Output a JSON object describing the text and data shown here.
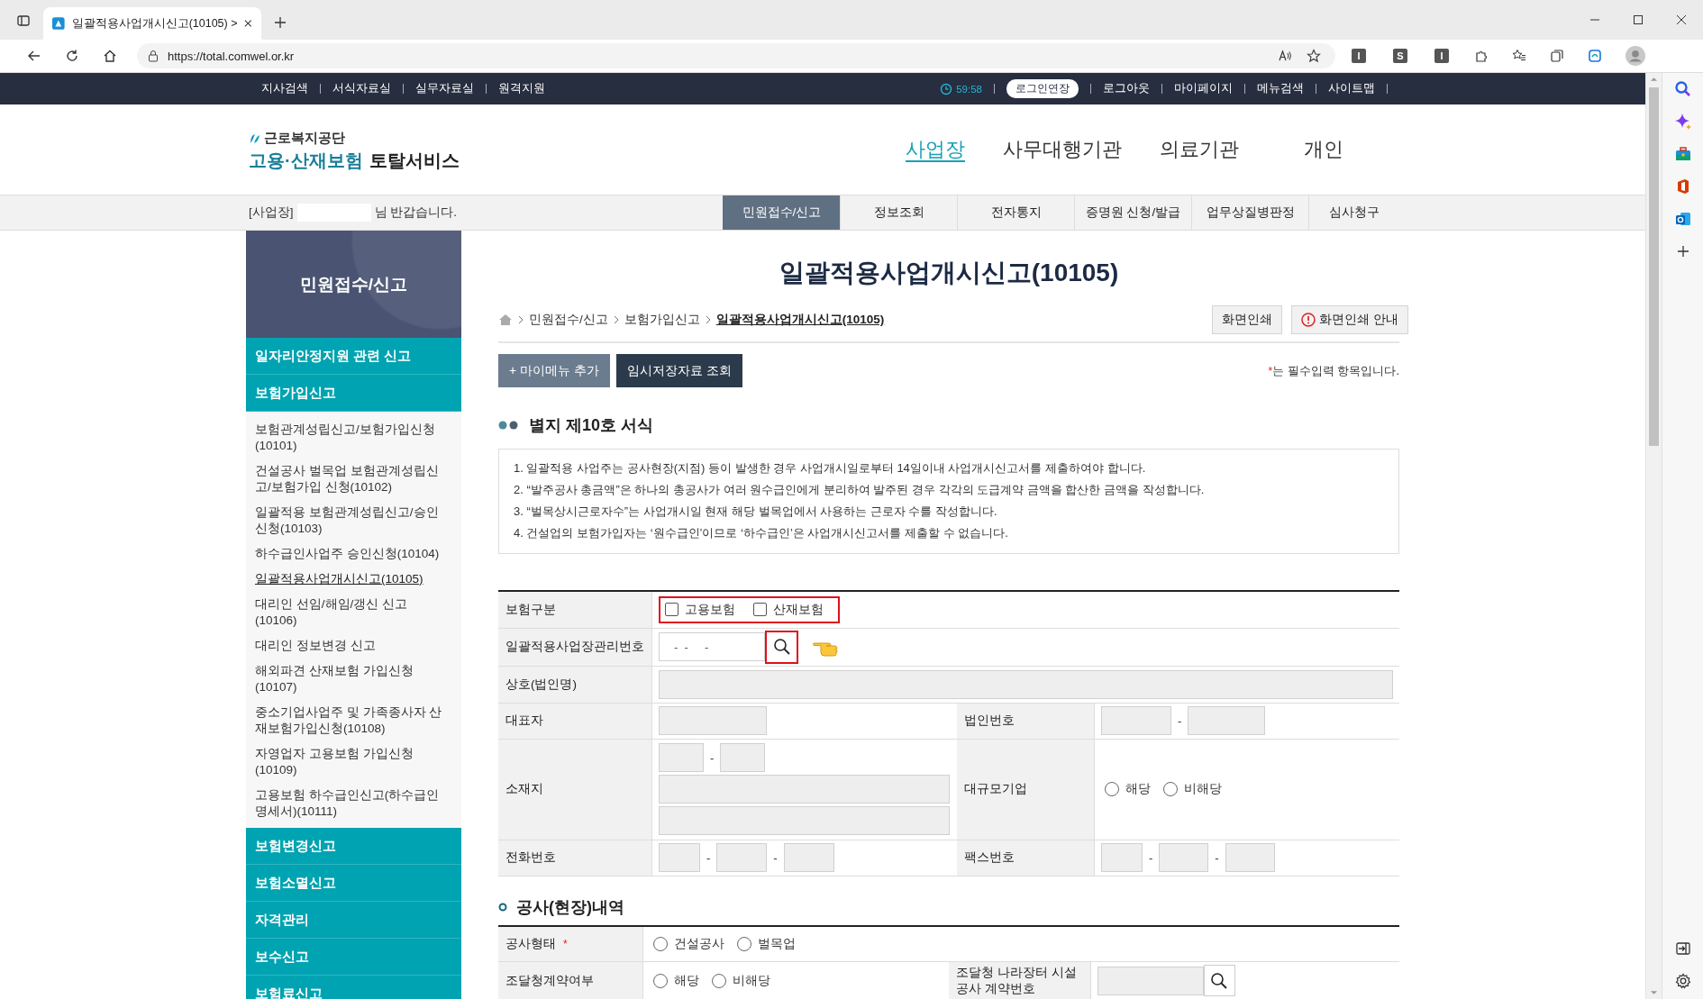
{
  "browser": {
    "tab_title": "일괄적용사업개시신고(10105) >",
    "url": "https://total.comwel.or.kr",
    "extension_icons": [
      "I",
      "S",
      "I"
    ]
  },
  "top_bar": {
    "left_links": [
      "지사검색",
      "서식자료실",
      "실무자료실",
      "원격지원"
    ],
    "timer": "59:58",
    "extend_button": "로그인연장",
    "right_links": [
      "로그아웃",
      "마이페이지",
      "메뉴검색",
      "사이트맵"
    ]
  },
  "header": {
    "org_name": "근로복지공단",
    "service_name_highlight": "고용·산재보험",
    "service_name": "토탈서비스",
    "nav": [
      {
        "label": "사업장",
        "selected": true
      },
      {
        "label": "사무대행기관",
        "selected": false
      },
      {
        "label": "의료기관",
        "selected": false
      },
      {
        "label": "개인",
        "selected": false
      }
    ]
  },
  "sub_bar": {
    "greeting_prefix": "[사업장]",
    "greeting_suffix": "님 반갑습니다.",
    "tabs": [
      {
        "label": "민원접수/신고",
        "selected": true
      },
      {
        "label": "정보조회",
        "selected": false
      },
      {
        "label": "전자통지",
        "selected": false
      },
      {
        "label": "증명원 신청/발급",
        "selected": false
      },
      {
        "label": "업무상질병판정",
        "selected": false
      },
      {
        "label": "심사청구",
        "selected": false
      }
    ]
  },
  "sidebar": {
    "title": "민원접수/신고",
    "groups": [
      {
        "label": "일자리안정지원 관련 신고"
      },
      {
        "label": "보험가입신고",
        "children": [
          {
            "label": "보험관계성립신고/보험가입신청(10101)",
            "selected": false
          },
          {
            "label": "건설공사 벌목업 보험관계성립신고/보험가입 신청(10102)",
            "selected": false
          },
          {
            "label": "일괄적용 보험관계성립신고/승인신청(10103)",
            "selected": false
          },
          {
            "label": "하수급인사업주 승인신청(10104)",
            "selected": false
          },
          {
            "label": "일괄적용사업개시신고(10105)",
            "selected": true
          },
          {
            "label": "대리인 선임/해임/갱신 신고(10106)",
            "selected": false
          },
          {
            "label": "대리인 정보변경 신고",
            "selected": false
          },
          {
            "label": "해외파견 산재보험 가입신청(10107)",
            "selected": false
          },
          {
            "label": "중소기업사업주 및 가족종사자 산재보험가입신청(10108)",
            "selected": false
          },
          {
            "label": "자영업자 고용보험 가입신청(10109)",
            "selected": false
          },
          {
            "label": "고용보험 하수급인신고(하수급인 명세서)(10111)",
            "selected": false
          }
        ]
      },
      {
        "label": "보험변경신고"
      },
      {
        "label": "보험소멸신고"
      },
      {
        "label": "자격관리"
      },
      {
        "label": "보수신고"
      },
      {
        "label": "보험료신고"
      }
    ]
  },
  "main": {
    "title": "일괄적용사업개시신고(10105)",
    "breadcrumb": [
      "민원접수/신고",
      "보험가입신고",
      "일괄적용사업개시신고(10105)"
    ],
    "print_buttons": [
      {
        "label": "화면인쇄",
        "kind": "plain"
      },
      {
        "label": "화면인쇄 안내",
        "kind": "info"
      }
    ],
    "action_buttons": [
      {
        "label": "+ 마이메뉴 추가",
        "kind": "light"
      },
      {
        "label": "임시저장자료 조회",
        "kind": "dark"
      }
    ],
    "required_mark": "*",
    "required_note": "는 필수입력 항목입니다.",
    "form_title": "별지 제10호 서식",
    "notices": [
      "1. 일괄적용 사업주는 공사현장(지점) 등이 발생한 경우 사업개시일로부터 14일이내 사업개시신고서를 제출하여야 합니다.",
      "2. “발주공사 총금액”은 하나의 총공사가 여러 원수급인에게 분리하여 발주된 경우 각각의 도급계약 금액을 합산한 금액을 작성합니다.",
      "3. “벌목상시근로자수”는 사업개시일 현재 해당 벌목업에서 사용하는 근로자 수를 작성합니다.",
      "4. 건설업의 보험가입자는 ‘원수급인’이므로 ‘하수급인’은 사업개시신고서를 제출할 수 없습니다."
    ]
  },
  "basic_form": {
    "insurance_type": {
      "label": "보험구분",
      "options": [
        {
          "label": "고용보험",
          "checked": false
        },
        {
          "label": "산재보험",
          "checked": false
        }
      ]
    },
    "site_number": {
      "label": "일괄적용사업장관리번호",
      "value": "-  -     -"
    },
    "company_name": {
      "label": "상호(법인명)"
    },
    "representative": {
      "label": "대표자"
    },
    "corp_number": {
      "label": "법인번호",
      "separator": "-"
    },
    "address": {
      "label": "소재지",
      "separator": "-"
    },
    "large_company": {
      "label": "대규모기업",
      "options": [
        {
          "label": "해당",
          "selected": false
        },
        {
          "label": "비해당",
          "selected": false
        }
      ]
    },
    "phone": {
      "label": "전화번호",
      "separators": [
        "-",
        "-"
      ]
    },
    "fax": {
      "label": "팩스번호",
      "separators": [
        "-",
        "-"
      ]
    }
  },
  "site_section": {
    "title": "공사(현장)내역",
    "work_type": {
      "label": "공사형태",
      "required_mark": "*",
      "options": [
        {
          "label": "건설공사",
          "selected": false
        },
        {
          "label": "벌목업",
          "selected": false
        }
      ]
    },
    "procurement": {
      "label": "조달청계약여부",
      "options": [
        {
          "label": "해당",
          "selected": false
        },
        {
          "label": "비해당",
          "selected": false
        }
      ]
    },
    "contract_number": {
      "label": "조달청 나라장터 시설 공사 계약번호"
    }
  }
}
